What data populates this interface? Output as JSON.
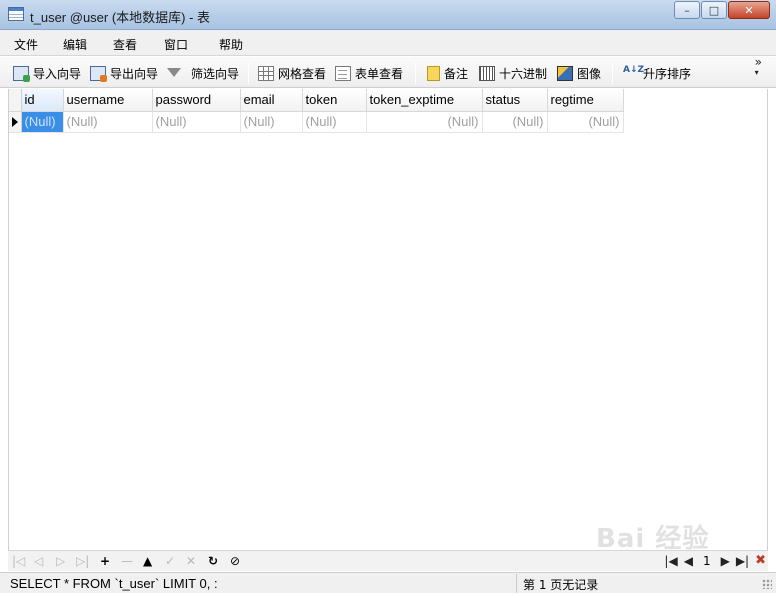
{
  "window": {
    "title": "t_user @user (本地数据库) - 表"
  },
  "menu": [
    "文件",
    "编辑",
    "查看",
    "窗口",
    "帮助"
  ],
  "toolbar": {
    "import_wizard": "导入向导",
    "export_wizard": "导出向导",
    "filter_wizard": "筛选向导",
    "grid_view": "网格查看",
    "form_view": "表单查看",
    "memo": "备注",
    "hex": "十六进制",
    "image": "图像",
    "sort_asc": "升序排序",
    "overflow": "»"
  },
  "grid": {
    "columns": [
      "id",
      "username",
      "password",
      "email",
      "token",
      "token_exptime",
      "status",
      "regtime"
    ],
    "rows": [
      [
        "(Null)",
        "(Null)",
        "(Null)",
        "(Null)",
        "(Null)",
        "(Null)",
        "(Null)",
        "(Null)"
      ]
    ]
  },
  "pager": {
    "page_number": "1"
  },
  "statusbar": {
    "sql": "SELECT * FROM `t_user` LIMIT 0, :",
    "record_info": "第 1 页无记录"
  },
  "watermark": "Bai 经验"
}
